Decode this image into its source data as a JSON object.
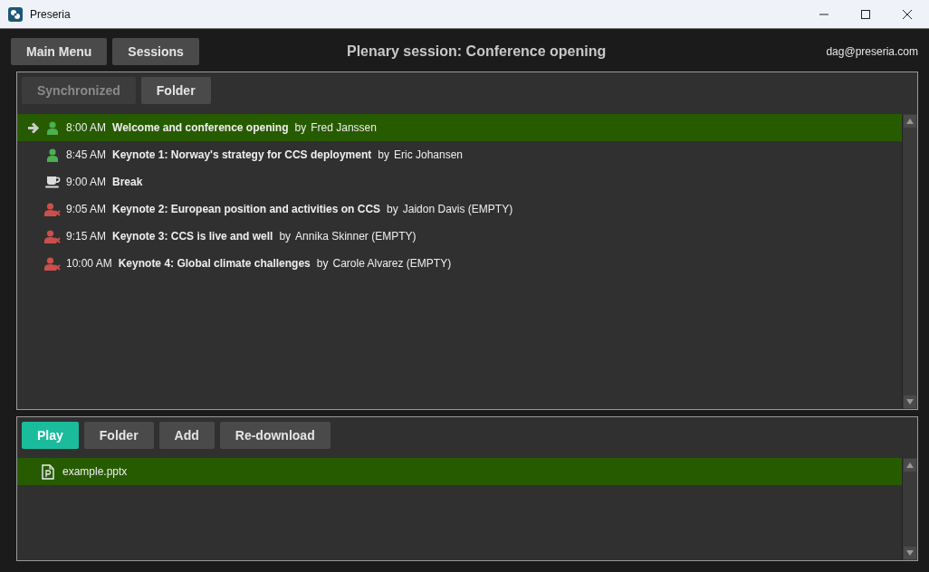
{
  "window": {
    "title": "Preseria"
  },
  "top_bar": {
    "buttons": [
      "Main Menu",
      "Sessions"
    ],
    "session_title": "Plenary session: Conference opening",
    "user": "dag@preseria.com"
  },
  "agenda_tabs": [
    {
      "label": "Synchronized",
      "disabled": true
    },
    {
      "label": "Folder",
      "disabled": false
    }
  ],
  "agenda": [
    {
      "kind": "speaker",
      "selected": true,
      "time": "8:00 AM",
      "title": "Welcome and conference opening",
      "by": "by",
      "speaker": "Fred Janssen"
    },
    {
      "kind": "speaker",
      "selected": false,
      "time": "8:45 AM",
      "title": "Keynote 1: Norway's strategy for CCS deployment",
      "by": "by",
      "speaker": "Eric Johansen"
    },
    {
      "kind": "break",
      "selected": false,
      "time": "9:00 AM",
      "title": "Break"
    },
    {
      "kind": "missing",
      "selected": false,
      "time": "9:05 AM",
      "title": "Keynote 2: European position and activities on CCS",
      "by": "by",
      "speaker": "Jaidon Davis (EMPTY)"
    },
    {
      "kind": "missing",
      "selected": false,
      "time": "9:15 AM",
      "title": "Keynote 3: CCS is live and well",
      "by": "by",
      "speaker": "Annika Skinner (EMPTY)"
    },
    {
      "kind": "missing",
      "selected": false,
      "time": "10:00 AM",
      "title": "Keynote 4: Global climate challenges",
      "by": "by",
      "speaker": "Carole Alvarez (EMPTY)"
    }
  ],
  "file_buttons": [
    {
      "label": "Play",
      "kind": "primary"
    },
    {
      "label": "Folder",
      "kind": "normal"
    },
    {
      "label": "Add",
      "kind": "normal"
    },
    {
      "label": "Re-download",
      "kind": "normal"
    }
  ],
  "files": [
    {
      "name": "example.pptx",
      "selected": true
    }
  ]
}
